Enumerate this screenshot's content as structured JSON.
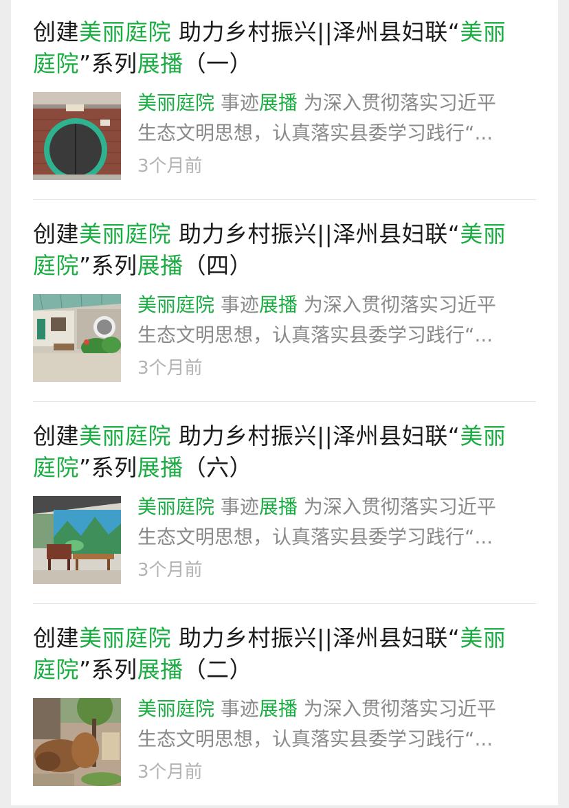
{
  "accent_color": "#1aad42",
  "articles": [
    {
      "title_pre": "创建",
      "title_hl1": "美丽庭院",
      "title_mid": " 助力乡村振兴||泽州县妇联“",
      "title_hl2a": "美丽",
      "title_hl2b": "庭院",
      "title_mid2": "”系列",
      "title_hl3": "展播",
      "title_post": "（一）",
      "desc_hl1": "美丽庭院",
      "desc_mid1": " 事迹",
      "desc_hl2": "展播",
      "desc_mid2": " 为深入贯彻落实习近平",
      "desc_line2": "生态文明思想，认真落实县委学习践行“...",
      "time": "3个月前",
      "thumb_icon": "courtyard-gate-photo"
    },
    {
      "title_pre": "创建",
      "title_hl1": "美丽庭院",
      "title_mid": " 助力乡村振兴||泽州县妇联“",
      "title_hl2a": "美丽",
      "title_hl2b": "庭院",
      "title_mid2": "”系列",
      "title_hl3": "展播",
      "title_post": "（四）",
      "desc_hl1": "美丽庭院",
      "desc_mid1": " 事迹",
      "desc_hl2": "展播",
      "desc_mid2": " 为深入贯彻落实习近平",
      "desc_line2": "生态文明思想，认真落实县委学习践行“...",
      "time": "3个月前",
      "thumb_icon": "courtyard-plants-photo"
    },
    {
      "title_pre": "创建",
      "title_hl1": "美丽庭院",
      "title_mid": " 助力乡村振兴||泽州县妇联“",
      "title_hl2a": "美丽",
      "title_hl2b": "庭院",
      "title_mid2": "”系列",
      "title_hl3": "展播",
      "title_post": "（六）",
      "desc_hl1": "美丽庭院",
      "desc_mid1": " 事迹",
      "desc_hl2": "展播",
      "desc_mid2": " 为深入贯彻落实习近平",
      "desc_line2": "生态文明思想，认真落实县委学习践行“...",
      "time": "3个月前",
      "thumb_icon": "courtyard-mural-photo"
    },
    {
      "title_pre": "创建",
      "title_hl1": "美丽庭院",
      "title_mid": " 助力乡村振兴||泽州县妇联“",
      "title_hl2a": "美丽",
      "title_hl2b": "庭院",
      "title_mid2": "”系列",
      "title_hl3": "展播",
      "title_post": "（二）",
      "desc_hl1": "美丽庭院",
      "desc_mid1": " 事迹",
      "desc_hl2": "展播",
      "desc_mid2": " 为深入贯彻落实习近平",
      "desc_line2": "生态文明思想，认真落实县委学习践行“...",
      "time": "3个月前",
      "thumb_icon": "courtyard-tree-photo"
    }
  ]
}
